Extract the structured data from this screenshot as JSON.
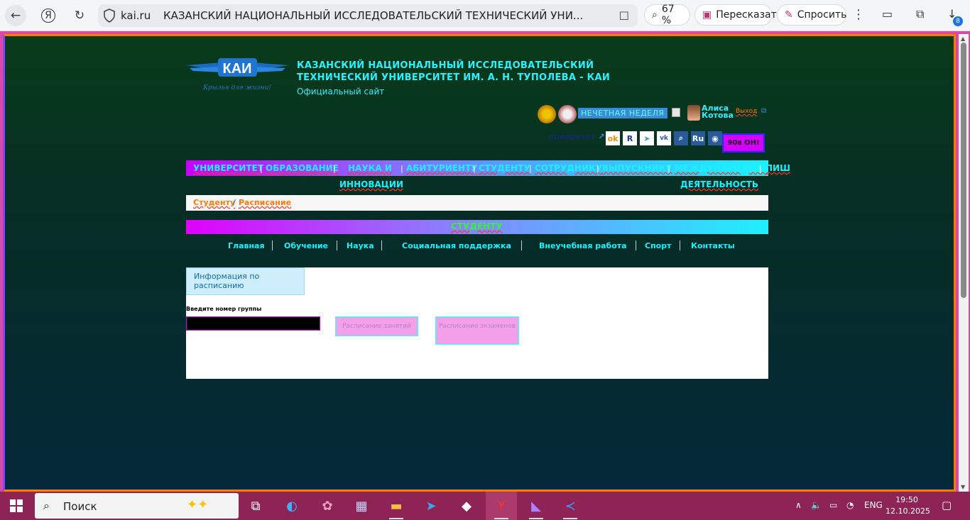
{
  "browser": {
    "domain": "kai.ru",
    "tab_title": "КАЗАНСКИЙ НАЦИОНАЛЬНЫЙ ИССЛЕДОВАТЕЛЬСКИЙ ТЕХНИЧЕСКИЙ УНИ...",
    "zoom": "67 %",
    "retell_label": "Пересказать",
    "ask_label": "Спросить",
    "downloads_badge": "8"
  },
  "header": {
    "logo_text": "КАИ",
    "logo_motto": "Крылья для жизни!",
    "title_line1": "КАЗАНСКИЙ НАЦИОНАЛЬНЫЙ ИССЛЕДОВАТЕЛЬСКИЙ",
    "title_line2": "ТЕХНИЧЕСКИЙ УНИВЕРСИТЕТ ИМ. А. Н. ТУПОЛЕВА - КАИ",
    "subtitle": "Официальный сайт",
    "week": "НЕЧЕТНАЯ НЕДЕЛЯ",
    "user_first": "Алиса",
    "user_last": "Котова",
    "logout": "Выход",
    "priority": "приоритет",
    "lang": "Ru",
    "anniversary": "90в ОН!"
  },
  "nav": {
    "items": [
      "УНИВЕРСИТЕТ",
      "ОБРАЗОВАНИЕ",
      "НАУКА И",
      "ИННОВАЦИИ",
      "АБИТУРИЕНТУ",
      "СТУДЕНТУ",
      "СОТРУДНИКУ",
      "ВЫПУСКНИКУ",
      "МЕЖДУНАРОДНАЯ",
      "ДЕЯТЕЛЬНОСТЬ",
      "ПИШ"
    ]
  },
  "breadcrumb": {
    "root": "Студенту",
    "sep": "/",
    "current": "Расписание"
  },
  "section": {
    "title": "СТУДЕНТУ",
    "subnav": [
      "Главная",
      "Обучение",
      "Наука",
      "Социальная поддержка",
      "Внеучебная работа",
      "Спорт",
      "Контакты"
    ]
  },
  "schedule": {
    "info_tab": "Информация по расписанию",
    "group_label": "Введите номер группы",
    "group_value": "",
    "btn_classes": "Расписание занятий",
    "btn_exams": "Расписание экзаменов"
  },
  "taskbar": {
    "search_placeholder": "Поиск",
    "lang": "ENG",
    "time": "19:50",
    "date": "12.10.2025"
  },
  "colors": {
    "accent_cyan": "#2ff0ff",
    "frame_orange": "#ff7a00",
    "taskbar": "#8e2456"
  }
}
